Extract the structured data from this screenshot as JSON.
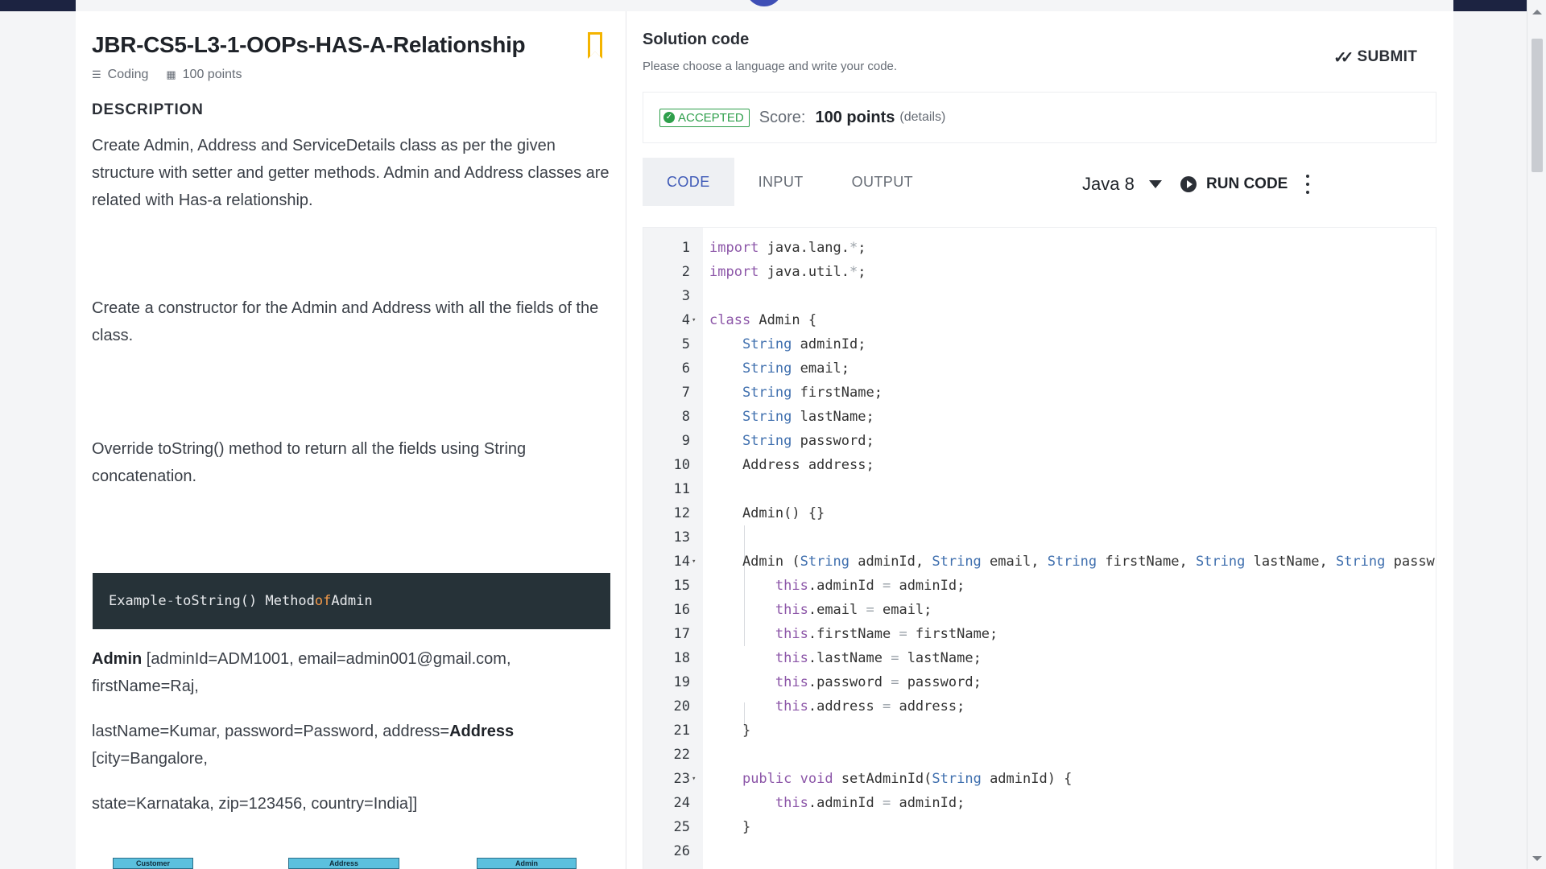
{
  "problem": {
    "title": "JBR-CS5-L3-1-OOPs-HAS-A-Relationship",
    "type_label": "Coding",
    "points_label": "100 points",
    "description_heading": "DESCRIPTION",
    "para1": "Create Admin, Address and ServiceDetails class as per the given structure with setter and getter methods. Admin and Address classes are related with Has-a relationship.",
    "para2": "Create a constructor for the Admin and Address with all the fields of the class.",
    "para3": "Override toString() method to return all the fields using String concatenation.",
    "example": {
      "prefix": "Example ",
      "arrow": "-",
      "mid": " toString() Method ",
      "kw": "of",
      "suffix": " Admin"
    },
    "out1_bold": "Admin",
    "out1_rest": " [adminId=ADM1001, email=admin001@gmail.com, firstName=Raj,",
    "out2_rest": "lastName=Kumar, password=Password, address=",
    "out2_bold": "Address",
    "out2_tail": " [city=Bangalore,",
    "out3": "state=Karnataka, zip=123456, country=India]]",
    "uml_boxes": [
      "Customer",
      "Address",
      "Admin"
    ]
  },
  "solution": {
    "title": "Solution code",
    "subtitle": "Please choose a language and write your code.",
    "submit_label": "SUBMIT",
    "status_badge": "ACCEPTED",
    "score_label": "Score:",
    "score_value": "100 points",
    "details_label": "(details)",
    "tabs": [
      "CODE",
      "INPUT",
      "OUTPUT"
    ],
    "active_tab": "CODE",
    "language": "Java 8",
    "run_label": "RUN CODE"
  },
  "colors": {
    "accent": "#3f5ab7",
    "accepted": "#2e9f4b",
    "bookmark": "#f4b400",
    "code_keyword": "#8c56a8",
    "code_type": "#3f6fae"
  },
  "icons": {
    "bookmark": "bookmark-icon",
    "submit": "double-check-icon",
    "run": "play-circle-icon",
    "menu": "kebab-menu-icon",
    "dropdown": "caret-down-icon"
  },
  "code_lines": [
    "import java.lang.*;",
    "import java.util.*;",
    "",
    "class Admin {",
    "    String adminId;",
    "    String email;",
    "    String firstName;",
    "    String lastName;",
    "    String password;",
    "    Address address;",
    "",
    "    Admin() {}",
    "",
    "    Admin (String adminId, String email, String firstName, String lastName, String passw",
    "        this.adminId = adminId;",
    "        this.email = email;",
    "        this.firstName = firstName;",
    "        this.lastName = lastName;",
    "        this.password = password;",
    "        this.address = address;",
    "    }",
    "",
    "    public void setAdminId(String adminId) {",
    "        this.adminId = adminId;",
    "    }",
    ""
  ],
  "fold_lines": [
    4,
    14,
    23
  ]
}
